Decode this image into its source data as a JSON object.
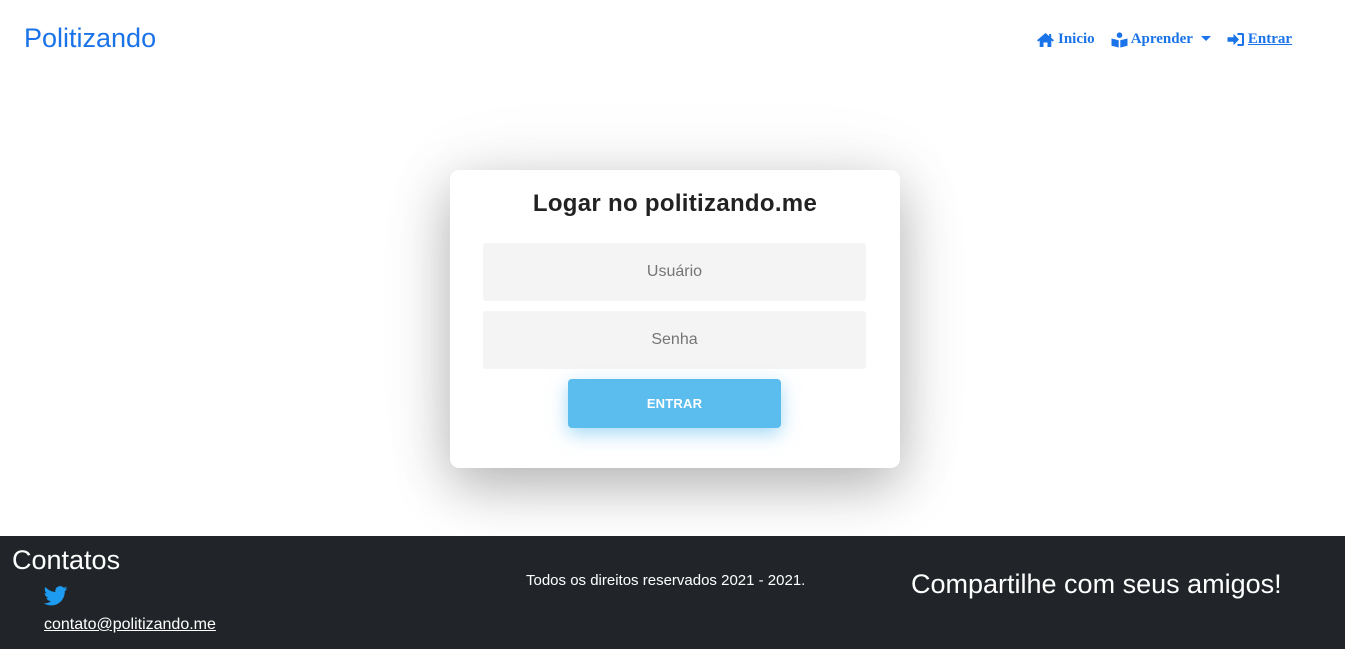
{
  "header": {
    "brand": "Politizando",
    "nav": {
      "home_label": "Inicio",
      "learn_label": "Aprender",
      "login_label": "Entrar"
    },
    "icons": {
      "home": "home-icon",
      "learn": "book-reader-icon",
      "dropdown": "caret-down-icon",
      "login": "sign-in-icon"
    }
  },
  "login": {
    "title": "Logar no politizando.me",
    "username_placeholder": "Usuário",
    "username_value": "",
    "password_placeholder": "Senha",
    "password_value": "",
    "submit_label": "ENTRAR"
  },
  "footer": {
    "contacts_title": "Contatos",
    "twitter_icon": "twitter-icon",
    "email": "contato@politizando.me",
    "copyright": "Todos os direitos reservados 2021 - 2021.",
    "share_text": "Compartilhe com seus amigos!"
  },
  "colors": {
    "accent": "#1a73e8",
    "button": "#5bbcee",
    "footer_bg": "#212529",
    "input_bg": "#f4f4f4"
  }
}
